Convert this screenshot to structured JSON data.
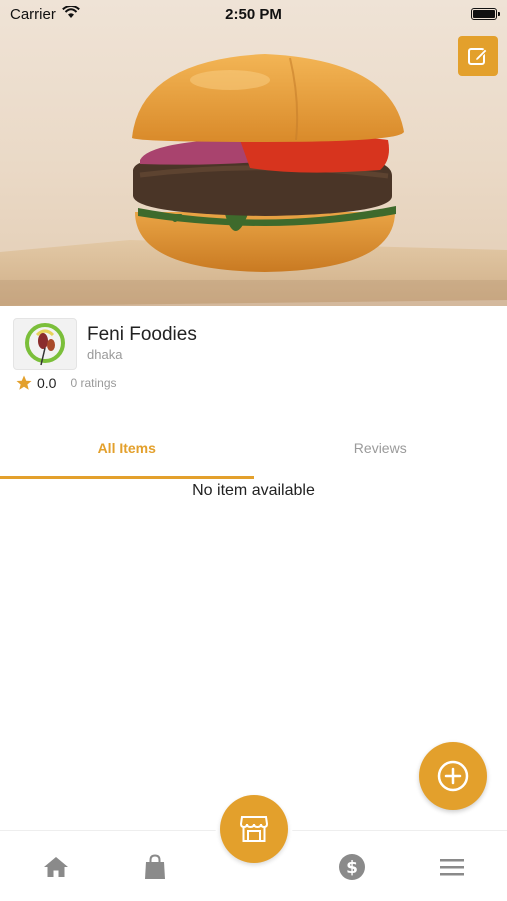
{
  "status_bar": {
    "carrier": "Carrier",
    "time": "2:50 PM"
  },
  "hero": {
    "edit_icon": "edit-icon"
  },
  "store": {
    "name": "Feni Foodies",
    "location": "dhaka",
    "rating": "0.0",
    "rating_count": "0 ratings"
  },
  "tabs": [
    {
      "label": "All Items",
      "active": true
    },
    {
      "label": "Reviews",
      "active": false
    }
  ],
  "content": {
    "empty_message": "No item available"
  },
  "bottom_nav": {
    "items": [
      "home-icon",
      "shopping-bag-icon",
      "store-icon",
      "dollar-icon",
      "menu-icon"
    ]
  },
  "colors": {
    "accent": "#e3a02c",
    "muted": "#9a9a9a"
  }
}
